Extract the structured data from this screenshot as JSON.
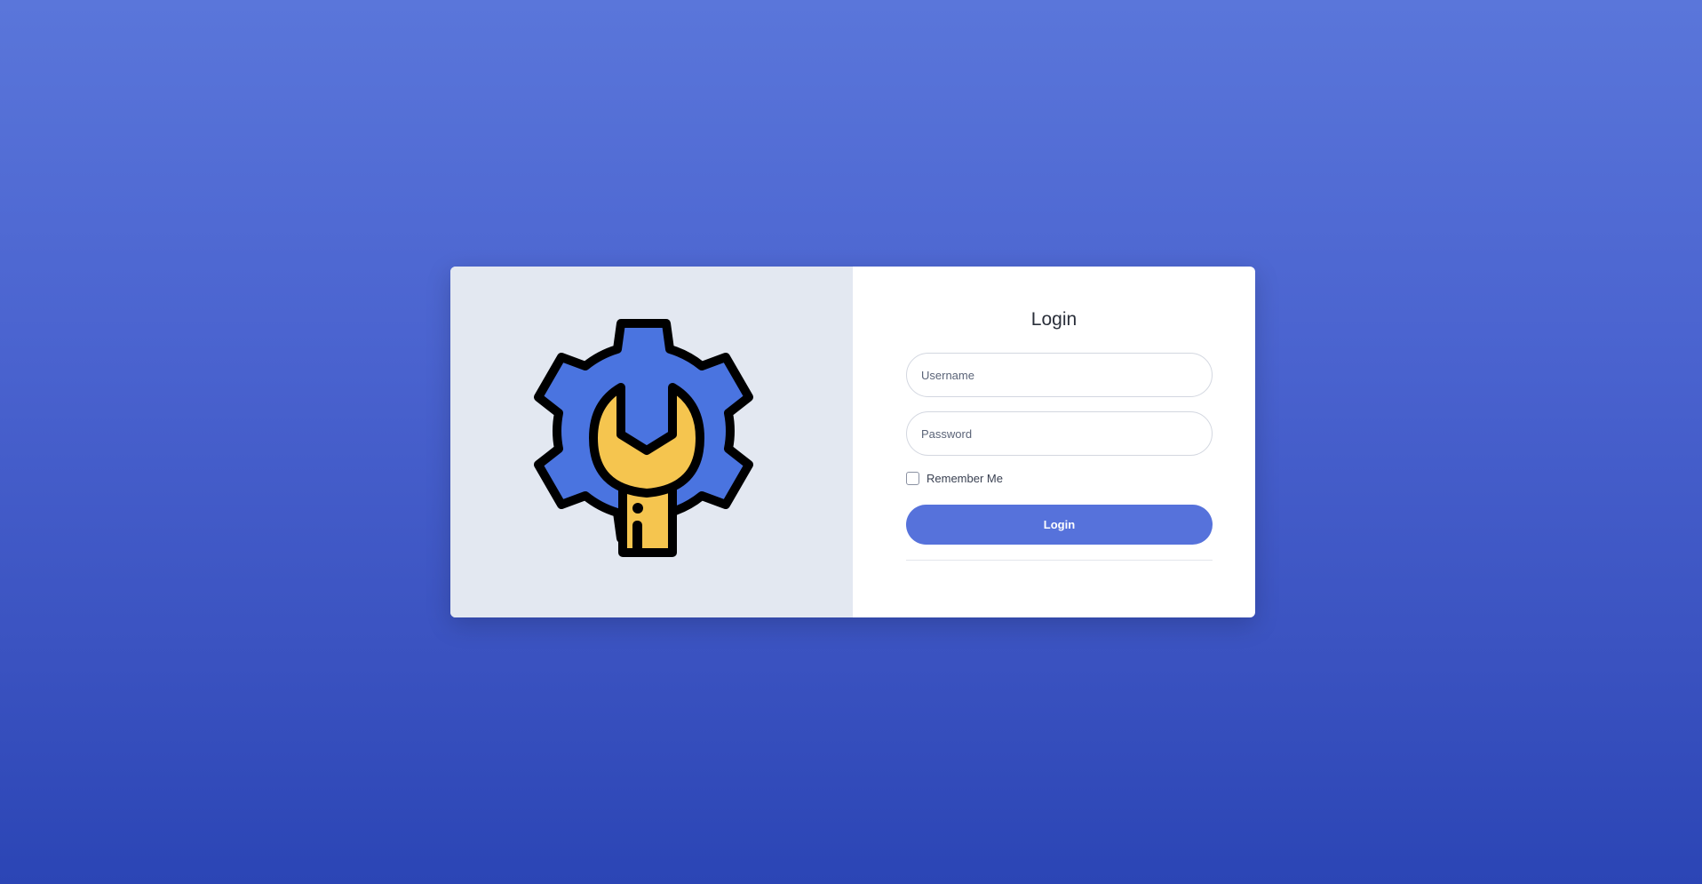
{
  "login": {
    "title": "Login",
    "username_placeholder": "Username",
    "password_placeholder": "Password",
    "remember_label": "Remember Me",
    "remember_checked": false,
    "submit_label": "Login"
  },
  "logo": {
    "icon": "gear-wrench-icon",
    "colors": {
      "gear": "#4a74e0",
      "wrench": "#f5c54f",
      "outline": "#000000"
    }
  },
  "theme": {
    "background_top": "#5a76da",
    "background_bottom": "#2b45b5",
    "accent": "#5672db",
    "left_panel": "#e3e8f1"
  }
}
